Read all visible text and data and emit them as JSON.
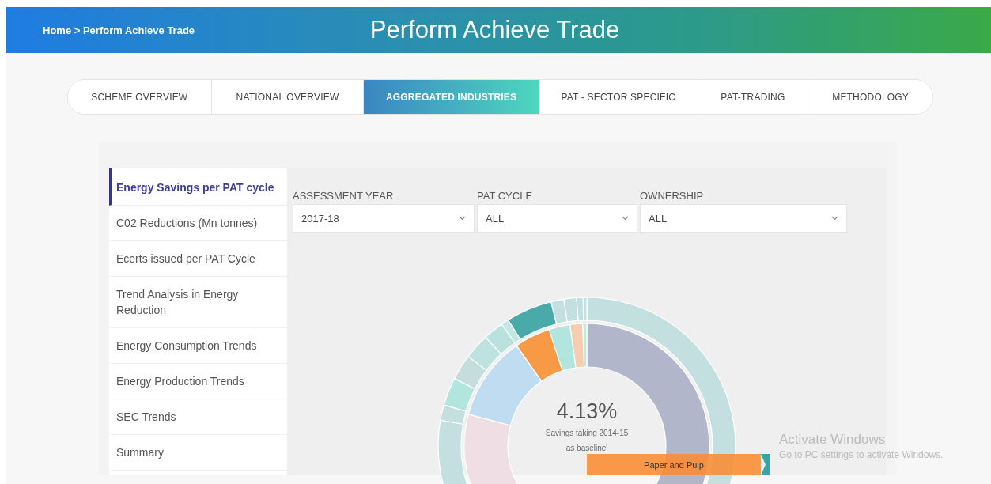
{
  "header": {
    "breadcrumb": "Home > Perform Achieve Trade",
    "title": "Perform Achieve Trade"
  },
  "tabs": [
    {
      "label": "SCHEME OVERVIEW",
      "selected": false
    },
    {
      "label": "NATIONAL OVERVIEW",
      "selected": false
    },
    {
      "label": "AGGREGATED INDUSTRIES",
      "selected": true
    },
    {
      "label": "PAT - SECTOR SPECIFIC",
      "selected": false
    },
    {
      "label": "PAT-TRADING",
      "selected": false
    },
    {
      "label": "METHODOLOGY",
      "selected": false
    }
  ],
  "sidebar": {
    "items": [
      {
        "label": "Energy Savings per PAT cycle",
        "selected": true
      },
      {
        "label": "C02 Reductions (Mn tonnes)",
        "selected": false
      },
      {
        "label": "Ecerts issued per PAT Cycle",
        "selected": false
      },
      {
        "label": "Trend Analysis in Energy Reduction",
        "selected": false
      },
      {
        "label": "Energy Consumption Trends",
        "selected": false
      },
      {
        "label": "Energy Production Trends",
        "selected": false
      },
      {
        "label": "SEC Trends",
        "selected": false
      },
      {
        "label": "Summary",
        "selected": false
      }
    ]
  },
  "filters": [
    {
      "label": "ASSESSMENT YEAR",
      "value": "2017-18"
    },
    {
      "label": "PAT CYCLE",
      "value": "ALL"
    },
    {
      "label": "OWNERSHIP",
      "value": "ALL"
    }
  ],
  "chart": {
    "center_value": "4.13%",
    "center_caption": "Savings taking 2014-15 as baseline'",
    "tooltip": "Paper and Pulp"
  },
  "os_overlay": {
    "title": "Activate Windows",
    "subtitle": "Go to PC settings to activate Windows."
  }
}
